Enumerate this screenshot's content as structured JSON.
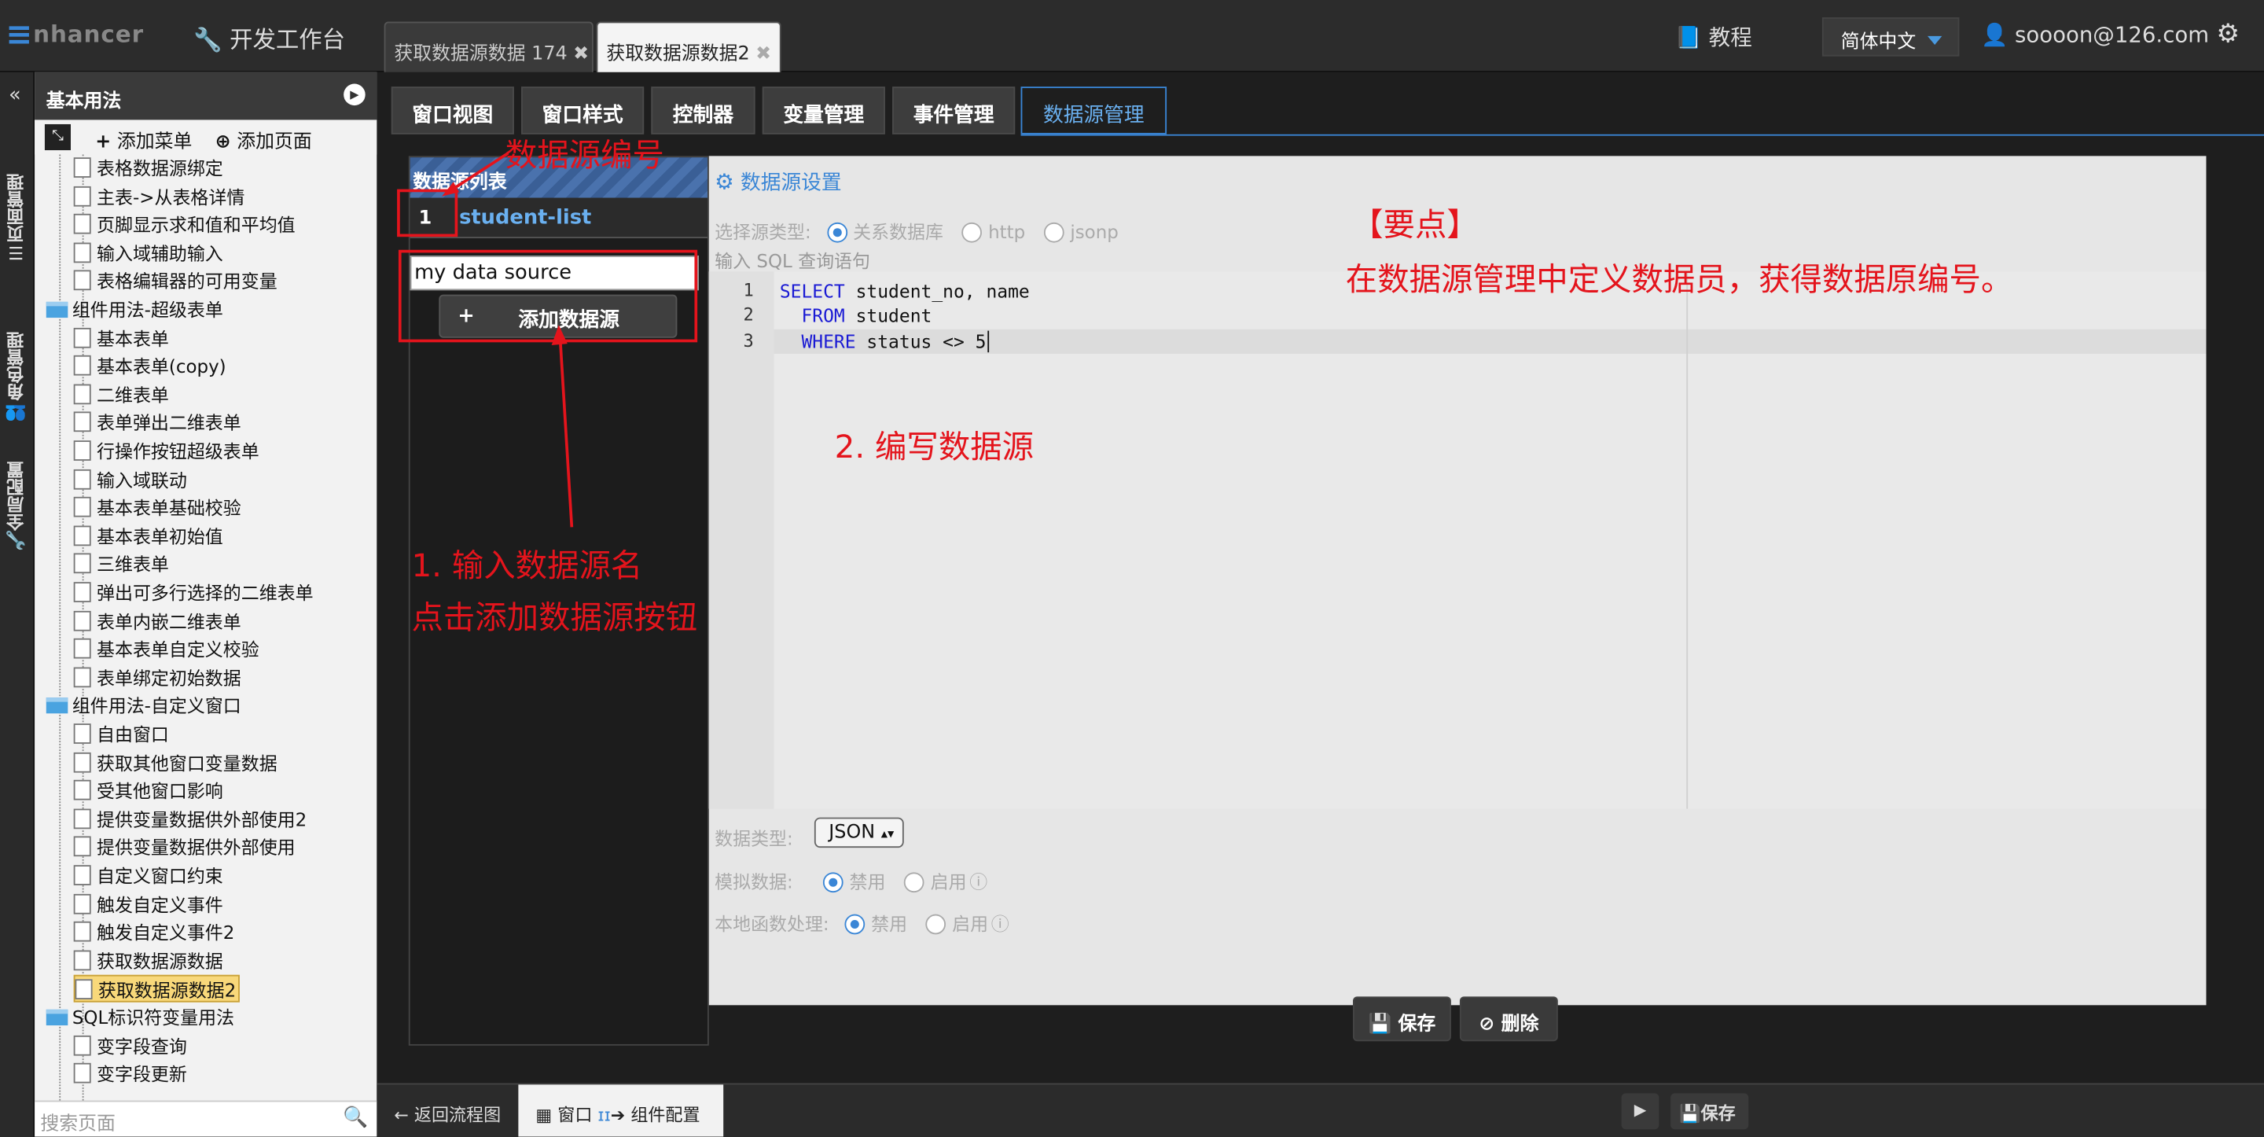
{
  "app": {
    "logo_mark": "≡",
    "logo_text": "nhancer",
    "workbench": "开发工作台"
  },
  "doc_tabs": [
    {
      "label": "获取数据源数据 174",
      "close": "✖"
    },
    {
      "label": "获取数据源数据2",
      "close": "✖"
    }
  ],
  "header": {
    "tutorial": "教程",
    "language": "简体中文",
    "user": "soooon@126.com"
  },
  "vstrip": {
    "collapse": "«",
    "tabs": [
      "☰页面管理",
      "👥角色管理",
      "🔧全局配置"
    ]
  },
  "tree": {
    "title": "基本用法",
    "add_menu": "添加菜单",
    "add_page": "添加页面",
    "items": [
      {
        "label": "表格数据源绑定",
        "type": "page"
      },
      {
        "label": "主表->从表格详情",
        "type": "page"
      },
      {
        "label": "页脚显示求和值和平均值",
        "type": "page"
      },
      {
        "label": "输入域辅助输入",
        "type": "page"
      },
      {
        "label": "表格编辑器的可用变量",
        "type": "page"
      },
      {
        "label": "组件用法-超级表单",
        "type": "folder"
      },
      {
        "label": "基本表单",
        "type": "page"
      },
      {
        "label": "基本表单(copy)",
        "type": "page"
      },
      {
        "label": "二维表单",
        "type": "page"
      },
      {
        "label": "表单弹出二维表单",
        "type": "page"
      },
      {
        "label": "行操作按钮超级表单",
        "type": "page"
      },
      {
        "label": "输入域联动",
        "type": "page"
      },
      {
        "label": "基本表单基础校验",
        "type": "page"
      },
      {
        "label": "基本表单初始值",
        "type": "page"
      },
      {
        "label": "三维表单",
        "type": "page"
      },
      {
        "label": "弹出可多行选择的二维表单",
        "type": "page"
      },
      {
        "label": "表单内嵌二维表单",
        "type": "page"
      },
      {
        "label": "基本表单自定义校验",
        "type": "page"
      },
      {
        "label": "表单绑定初始数据",
        "type": "page"
      },
      {
        "label": "组件用法-自定义窗口",
        "type": "folder"
      },
      {
        "label": "自由窗口",
        "type": "page"
      },
      {
        "label": "获取其他窗口变量数据",
        "type": "page"
      },
      {
        "label": "受其他窗口影响",
        "type": "page"
      },
      {
        "label": "提供变量数据供外部使用2",
        "type": "page"
      },
      {
        "label": "提供变量数据供外部使用",
        "type": "page"
      },
      {
        "label": "自定义窗口约束",
        "type": "page"
      },
      {
        "label": "触发自定义事件",
        "type": "page"
      },
      {
        "label": "触发自定义事件2",
        "type": "page"
      },
      {
        "label": "获取数据源数据",
        "type": "page"
      },
      {
        "label": "获取数据源数据2",
        "type": "page",
        "selected": true
      },
      {
        "label": "SQL标识符变量用法",
        "type": "folder"
      },
      {
        "label": "变字段查询",
        "type": "page"
      },
      {
        "label": "变字段更新",
        "type": "page"
      }
    ],
    "search_placeholder": "搜索页面"
  },
  "main_tabs": [
    "窗口视图",
    "窗口样式",
    "控制器",
    "变量管理",
    "事件管理",
    "数据源管理"
  ],
  "datasource": {
    "list_title": "数据源列表",
    "items": [
      {
        "num": "1",
        "name": "student-list"
      }
    ],
    "new_name_value": "my data source",
    "add_button": "添加数据源",
    "add_plus": "+"
  },
  "settings": {
    "title": "数据源设置",
    "source_type_label": "选择源类型:",
    "source_types": [
      "关系数据库",
      "http",
      "jsonp"
    ],
    "sql_label": "输入 SQL 查询语句",
    "code_lines": [
      {
        "n": "1",
        "kw": "SELECT",
        "rest": " student_no, name"
      },
      {
        "n": "2",
        "kw": "  FROM",
        "rest": " student"
      },
      {
        "n": "3",
        "kw": "  WHERE",
        "rest": " status <> 5"
      }
    ],
    "data_type_label": "数据类型:",
    "data_type_value": "JSON",
    "mock_label": "模拟数据:",
    "local_fn_label": "本地函数处理:",
    "disable": "禁用",
    "enable": "启用"
  },
  "actions": {
    "save": "保存",
    "delete": "删除"
  },
  "bottombar": {
    "back": "返回流程图",
    "window": "窗口",
    "config": "组件配置",
    "save": "保存"
  },
  "annotations": {
    "ds_number": "数据源编号",
    "key_point_title": "【要点】",
    "key_point_text": "在数据源管理中定义数据员，获得数据原编号。",
    "step1_line1": "1. 输入数据源名",
    "step1_line2": "点击添加数据源按钮",
    "step2": "2. 编写数据源"
  },
  "colors": {
    "accent": "#3a86d6",
    "annotation": "#e4141c",
    "selected_node": "#f8d87a"
  }
}
